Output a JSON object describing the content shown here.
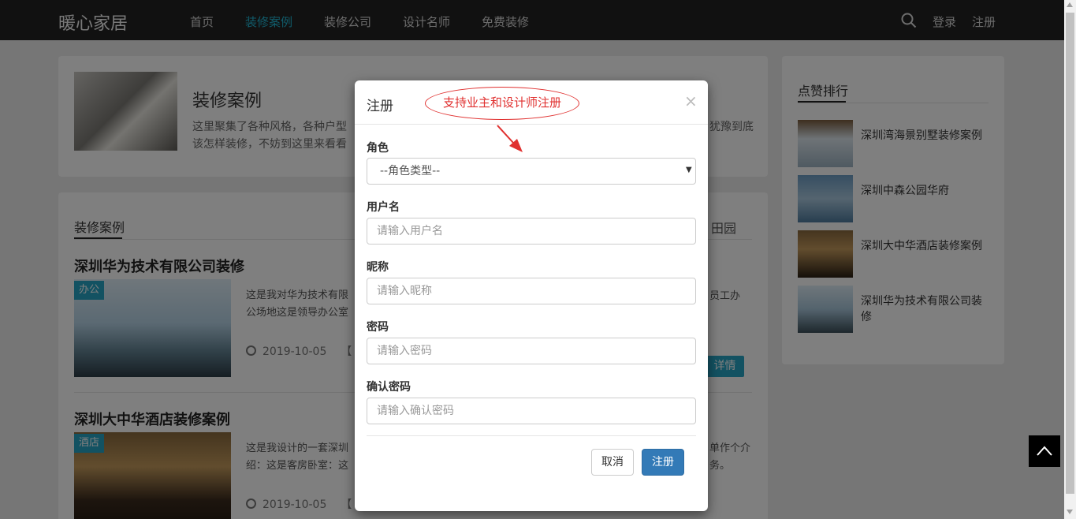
{
  "navbar": {
    "brand": "暖心家居",
    "links": [
      "首页",
      "装修案例",
      "装修公司",
      "设计名师",
      "免费装修"
    ],
    "active_index": 1,
    "login": "登录",
    "register": "注册",
    "accent": "#22b8d6"
  },
  "hero": {
    "title": "装修案例",
    "desc_line1": "这里聚集了各种风格，各种户型",
    "desc_line2": "该怎样装修，不妨到这里来看看",
    "desc_right": "犹豫到底"
  },
  "cases": {
    "section_title": "装修案例",
    "side_tab": "田园",
    "items": [
      {
        "title": "深圳华为技术有限公司装修",
        "tag": "办公",
        "desc_line1": "这是我对华为技术有限",
        "desc_line2": "公场地这是领导办公室",
        "desc_right": "员工办",
        "date": "2019-10-05",
        "date_tail": "【",
        "button": "详情"
      },
      {
        "title": "深圳大中华酒店装修案例",
        "tag": "酒店",
        "desc_line1": "这是我设计的一套深圳",
        "desc_line2": "绍：这是客房卧室：这",
        "desc_right1": "单作个介",
        "desc_right2": "务。",
        "date": "2019-10-05",
        "date_tail": "【"
      }
    ]
  },
  "ranking": {
    "title": "点赞排行",
    "items": [
      "深圳湾海景别墅装修案例",
      "深圳中森公园华府",
      "深圳大中华酒店装修案例",
      "深圳华为技术有限公司装修"
    ]
  },
  "modal": {
    "title": "注册",
    "close": "×",
    "annotation": "支持业主和设计师注册",
    "role_label": "角色",
    "role_selected": "--角色类型--",
    "username_label": "用户名",
    "username_placeholder": "请输入用户名",
    "nickname_label": "昵称",
    "nickname_placeholder": "请输入昵称",
    "password_label": "密码",
    "password_placeholder": "请输入密码",
    "confirm_label": "确认密码",
    "confirm_placeholder": "请输入确认密码",
    "cancel": "取消",
    "submit": "注册",
    "primary_color": "#337ab7",
    "annotation_color": "#e0302f"
  }
}
